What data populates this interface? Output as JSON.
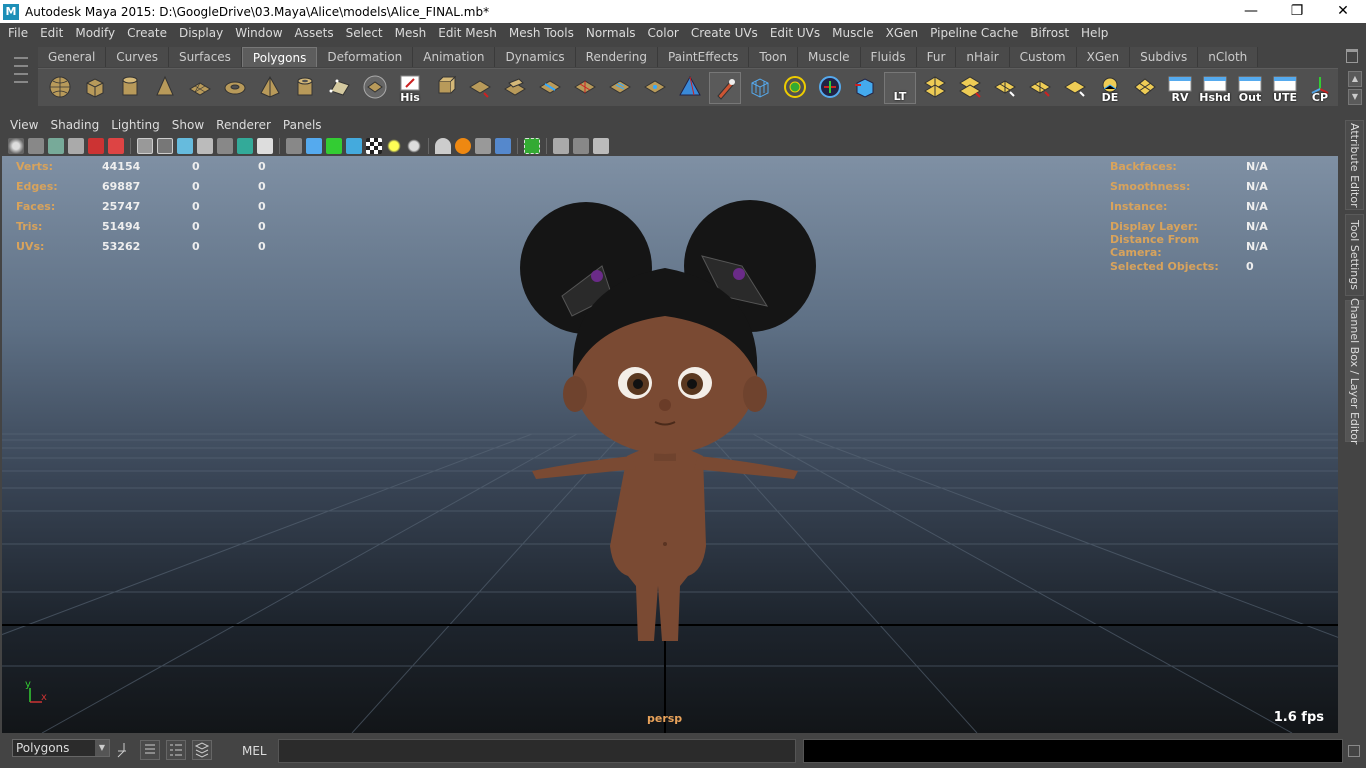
{
  "window": {
    "title": "Autodesk Maya 2015: D:\\GoogleDrive\\03.Maya\\Alice\\models\\Alice_FINAL.mb*",
    "minimize": "—",
    "restore": "❐",
    "close": "✕"
  },
  "menubar": [
    "File",
    "Edit",
    "Modify",
    "Create",
    "Display",
    "Window",
    "Assets",
    "Select",
    "Mesh",
    "Edit Mesh",
    "Mesh Tools",
    "Normals",
    "Color",
    "Create UVs",
    "Edit UVs",
    "Muscle",
    "XGen",
    "Pipeline Cache",
    "Bifrost",
    "Help"
  ],
  "shelf": {
    "tabs": [
      "General",
      "Curves",
      "Surfaces",
      "Polygons",
      "Deformation",
      "Animation",
      "Dynamics",
      "Rendering",
      "PaintEffects",
      "Toon",
      "Muscle",
      "Fluids",
      "Fur",
      "nHair",
      "Custom",
      "XGen",
      "Subdivs",
      "nCloth"
    ],
    "active_tab": "Polygons",
    "icon_labels": {
      "his": "His",
      "lt": "LT",
      "de": "DE",
      "rv": "RV",
      "hshd": "Hshd",
      "out": "Out",
      "ute": "UTE",
      "cp": "CP"
    },
    "scroll_up": "▲",
    "scroll_down": "▼"
  },
  "panel_menu": [
    "View",
    "Shading",
    "Lighting",
    "Show",
    "Renderer",
    "Panels"
  ],
  "hud": {
    "left": [
      {
        "label": "Verts:",
        "total": "44154",
        "sel": "0",
        "comp": "0"
      },
      {
        "label": "Edges:",
        "total": "69887",
        "sel": "0",
        "comp": "0"
      },
      {
        "label": "Faces:",
        "total": "25747",
        "sel": "0",
        "comp": "0"
      },
      {
        "label": "Tris:",
        "total": "51494",
        "sel": "0",
        "comp": "0"
      },
      {
        "label": "UVs:",
        "total": "53262",
        "sel": "0",
        "comp": "0"
      }
    ],
    "right": [
      {
        "label": "Backfaces:",
        "value": "N/A"
      },
      {
        "label": "Smoothness:",
        "value": "N/A"
      },
      {
        "label": "Instance:",
        "value": "N/A"
      },
      {
        "label": "Display Layer:",
        "value": "N/A"
      },
      {
        "label": "Distance From Camera:",
        "value": "N/A"
      },
      {
        "label": "Selected Objects:",
        "value": "0"
      }
    ],
    "camera": "persp",
    "fps": "1.6 fps",
    "axis_y": "y",
    "axis_x": "x"
  },
  "side_tabs": [
    "Attribute Editor",
    "Tool Settings",
    "Channel Box / Layer Editor"
  ],
  "statusbar": {
    "mode": "Polygons",
    "mode_arrow": "▼",
    "mel_label": "MEL"
  },
  "colors": {
    "hud_label": "#d8a35c",
    "camera_label": "#e8a25a",
    "skin": "#7a4a33",
    "hair": "#151515"
  }
}
